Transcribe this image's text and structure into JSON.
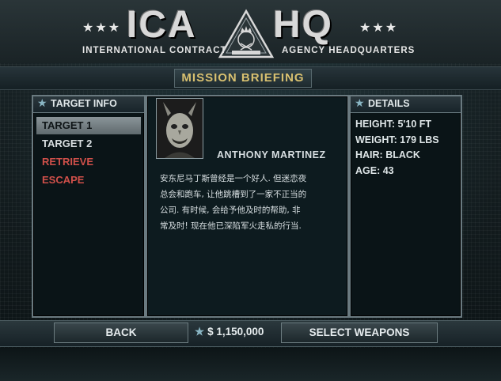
{
  "header": {
    "stars_left": "★★★",
    "stars_right": "★★★",
    "title_left": "ICA",
    "title_right": "HQ",
    "subtitle_left": "INTERNATIONAL CONTRACT",
    "subtitle_right": "AGENCY HEADQUARTERS",
    "emblem_icon": "ica-crown-emblem-icon"
  },
  "screen_title": "MISSION BRIEFING",
  "target_info": {
    "heading": "TARGET INFO",
    "items": [
      {
        "label": "TARGET 1",
        "state": "selected"
      },
      {
        "label": "TARGET 2",
        "state": "normal"
      },
      {
        "label": "RETRIEVE",
        "state": "red"
      },
      {
        "label": "ESCAPE",
        "state": "red"
      }
    ]
  },
  "briefing": {
    "portrait_icon": "masked-target-portrait",
    "target_name": "ANTHONY MARTINEZ",
    "description_lines": [
      "安东尼马丁斯曾经是一个好人. 但迷恋夜",
      "总会和跑车, 让他跳槽到了一家不正当的",
      "公司. 有时候, 会给予他及时的帮助, 非",
      "常及时! 现在他已深陷军火走私的行当."
    ]
  },
  "details": {
    "heading": "DETAILS",
    "rows": [
      "HEIGHT: 5'10 FT",
      "WEIGHT: 179 LBS",
      "HAIR: BLACK",
      "AGE: 43"
    ]
  },
  "footer": {
    "back_label": "BACK",
    "money": "$ 1,150,000",
    "select_weapons_label": "SELECT WEAPONS"
  },
  "colors": {
    "accent_gold": "#d8c070",
    "alert_red": "#d0504a",
    "star_blue": "#8ab6c4"
  }
}
